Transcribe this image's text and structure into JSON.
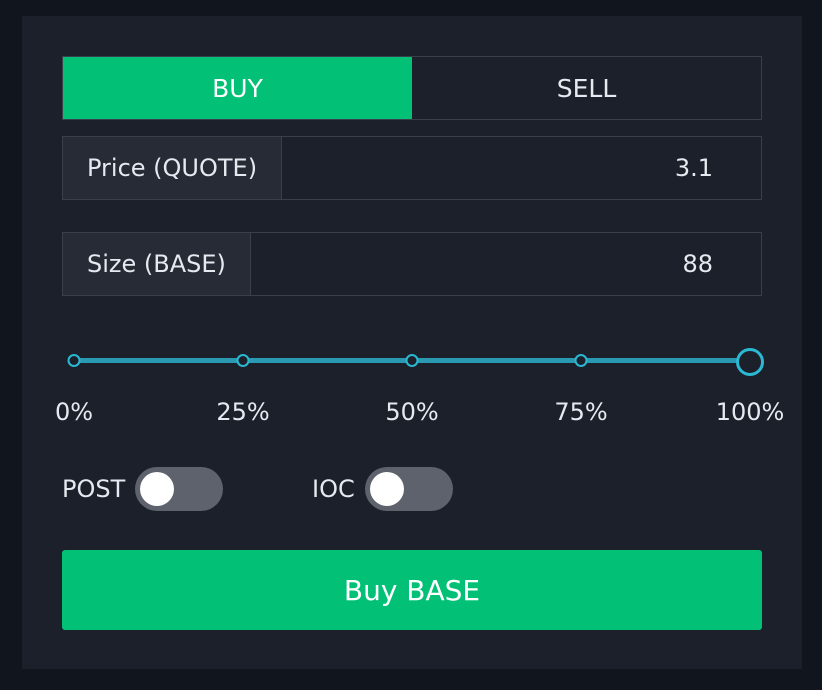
{
  "tabs": [
    {
      "label": "BUY",
      "active": true
    },
    {
      "label": "SELL",
      "active": false
    }
  ],
  "price": {
    "label": "Price (QUOTE)",
    "value": "3.1"
  },
  "size": {
    "label": "Size (BASE)",
    "value": "88"
  },
  "slider": {
    "value_percent": 100,
    "marks": [
      "0%",
      "25%",
      "50%",
      "75%",
      "100%"
    ]
  },
  "toggles": {
    "post": {
      "label": "POST",
      "on": false
    },
    "ioc": {
      "label": "IOC",
      "on": false
    }
  },
  "submit": {
    "label": "Buy BASE"
  },
  "colors": {
    "accent": "#02c076",
    "slider": "#2ab8d3",
    "panel": "#1b202a",
    "background": "#11151d"
  }
}
